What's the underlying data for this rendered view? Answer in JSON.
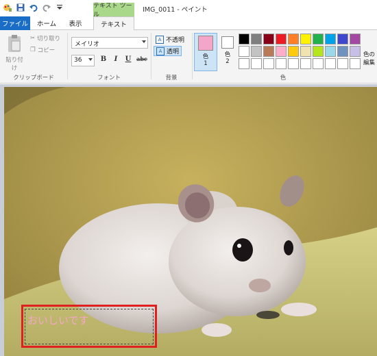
{
  "window": {
    "title": "IMG_0011 - ペイント"
  },
  "context_tab_header": "テキスト ツール",
  "tabs": {
    "file": "ファイル",
    "home": "ホーム",
    "view": "表示",
    "text": "テキスト"
  },
  "clipboard": {
    "paste": "貼り付け",
    "cut": "切り取り",
    "copy": "コピー",
    "group": "クリップボード"
  },
  "font": {
    "family": "メイリオ",
    "size": "36",
    "bold": "B",
    "italic": "I",
    "underline": "U",
    "strike": "abc",
    "group": "フォント"
  },
  "background": {
    "opaque": "不透明",
    "transparent": "透明",
    "group": "背景"
  },
  "colors": {
    "color1_label": "色",
    "color1_num": "1",
    "color2_label": "色",
    "color2_num": "2",
    "group": "色",
    "edit_label_1": "色の",
    "edit_label_2": "編集",
    "color1": "#f4a6c8",
    "color2": "#ffffff",
    "palette": [
      "#000000",
      "#7f7f7f",
      "#880015",
      "#ed1c24",
      "#ff7f27",
      "#fff200",
      "#22b14c",
      "#00a2e8",
      "#3f48cc",
      "#a349a4",
      "#ffffff",
      "#c3c3c3",
      "#b97a57",
      "#ffaec9",
      "#ffc90e",
      "#efe4b0",
      "#b5e61d",
      "#99d9ea",
      "#7092be",
      "#c8bfe7",
      "#ffffff",
      "#ffffff",
      "#ffffff",
      "#ffffff",
      "#ffffff",
      "#ffffff",
      "#ffffff",
      "#ffffff",
      "#ffffff",
      "#ffffff"
    ]
  },
  "canvas": {
    "text": "おいしいです"
  }
}
